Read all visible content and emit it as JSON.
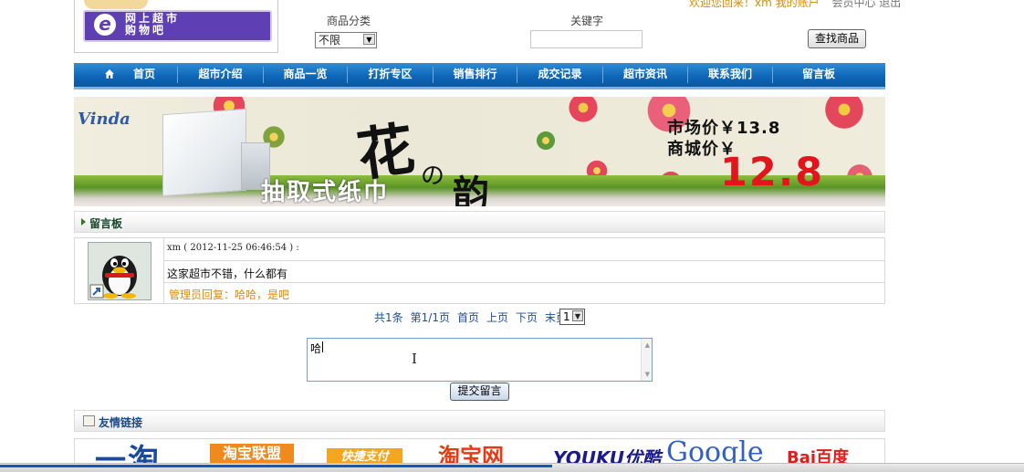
{
  "header": {
    "logo_text_line1": "网上超市",
    "logo_text_line2": "购物吧",
    "logo_letter": "e",
    "top_links": {
      "welcome": "欢迎您回来！xm 我的账户",
      "links": "会员中心 退出"
    },
    "category_label": "商品分类",
    "category_value": "不限",
    "keyword_label": "关键字",
    "keyword_value": "",
    "search_button": "查找商品"
  },
  "nav": {
    "items": [
      {
        "label": "首页"
      },
      {
        "label": "超市介绍"
      },
      {
        "label": "商品一览"
      },
      {
        "label": "打折专区"
      },
      {
        "label": "销售排行"
      },
      {
        "label": "成交记录"
      },
      {
        "label": "超市资讯"
      },
      {
        "label": "联系我们"
      },
      {
        "label": "留言板"
      }
    ]
  },
  "banner": {
    "brand": "Vinda",
    "calligraphy_main": "花",
    "calligraphy_no": "の",
    "calligraphy_yun": "韵",
    "bottom_text": "抽取式纸巾",
    "market_price": "市场价￥13.8",
    "mall_price_label": "商城价￥",
    "mall_price_value": "12.8"
  },
  "board": {
    "title": "留言板",
    "message": {
      "meta": "xm ( 2012-11-25 06:46:54 ) :",
      "content": "这家超市不错，什么都有",
      "reply": "管理员回复：哈哈，是吧"
    },
    "pager": {
      "total": "共1条",
      "page_of": "第1/1页",
      "first": "首页",
      "prev": "上页",
      "next": "下页",
      "last": "末页",
      "page_select_value": "1"
    },
    "input_text": "哈",
    "submit_button": "提交留言"
  },
  "links": {
    "title": "友情链接",
    "logos": [
      "一淘",
      "淘宝联盟",
      "快捷支付",
      "淘宝网",
      "YOUKU优酷",
      "Google",
      "Bai百度"
    ]
  },
  "colors": {
    "nav_blue": "#0f67b8",
    "reply_orange": "#e08a00",
    "price_red": "#e0161c",
    "pager_blue": "#1a4f9c"
  },
  "icons": {
    "home": "home-icon",
    "board_arrow": "triangle-right-icon",
    "links": "links-icon"
  }
}
